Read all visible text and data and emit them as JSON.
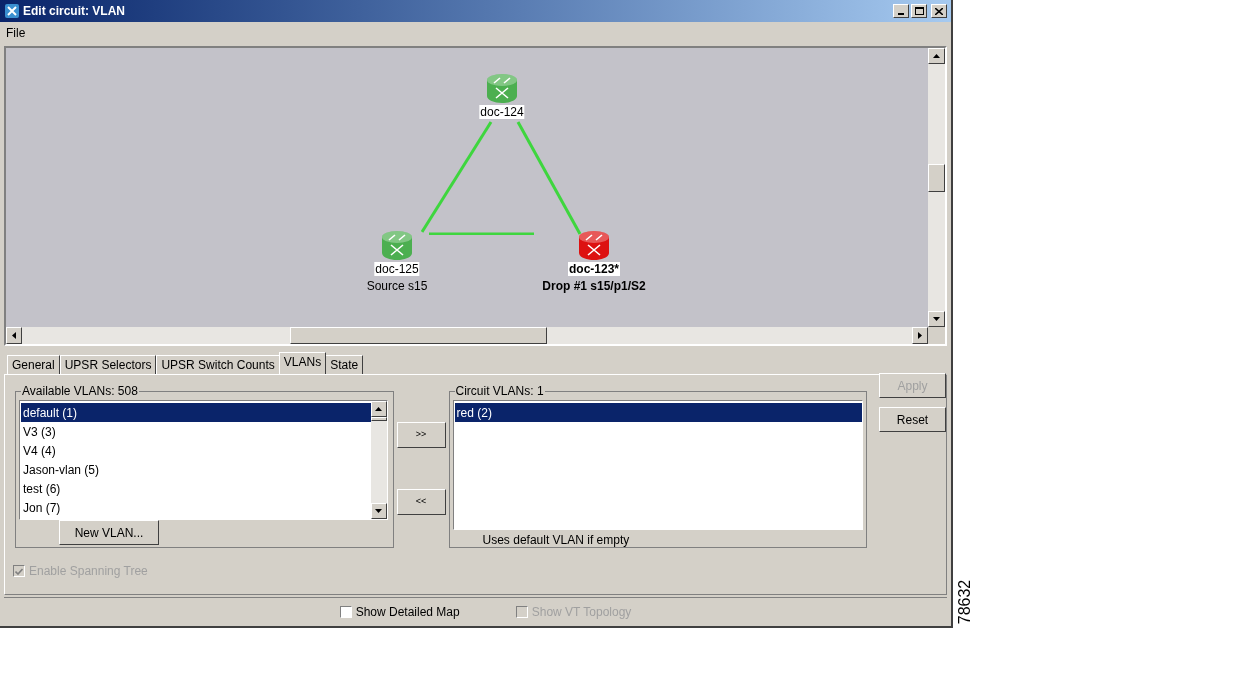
{
  "window": {
    "title": "Edit circuit: VLAN"
  },
  "menu": [
    "File"
  ],
  "map": {
    "nodes": [
      {
        "name": "doc-124",
        "color": "#4caf50",
        "selected": false
      },
      {
        "name": "doc-125",
        "subtitle": "Source s15",
        "color": "#4caf50",
        "selected": false
      },
      {
        "name": "doc-123*",
        "subtitle": "Drop #1 s15/p1/S2",
        "color": "#dd1111",
        "selected": true
      }
    ]
  },
  "tabs": [
    {
      "label": "General",
      "selected": false
    },
    {
      "label": "UPSR Selectors",
      "selected": false
    },
    {
      "label": "UPSR Switch Counts",
      "selected": false
    },
    {
      "label": "VLANs",
      "selected": true
    },
    {
      "label": "State",
      "selected": false
    }
  ],
  "available_vlans": {
    "title": "Available VLANs: 508",
    "items": [
      {
        "label": "default (1)",
        "selected": true
      },
      {
        "label": "V3 (3)",
        "selected": false
      },
      {
        "label": "V4 (4)",
        "selected": false
      },
      {
        "label": "Jason-vlan (5)",
        "selected": false
      },
      {
        "label": "test (6)",
        "selected": false
      },
      {
        "label": "Jon (7)",
        "selected": false
      }
    ],
    "button": "New VLAN..."
  },
  "move_buttons": [
    ">>",
    "<<"
  ],
  "circuit_vlans": {
    "title": "Circuit VLANs: 1",
    "items": [
      {
        "label": "red (2)",
        "selected": true
      }
    ],
    "note": "Uses default VLAN if empty"
  },
  "side_buttons": [
    {
      "label": "Apply",
      "disabled": true
    },
    {
      "label": "Reset",
      "disabled": false
    }
  ],
  "enable_spanning_tree": {
    "label": "Enable Spanning Tree",
    "checked": true,
    "disabled": true
  },
  "bottom_options": [
    {
      "label": "Show Detailed Map",
      "checked": false,
      "disabled": false
    },
    {
      "label": "Show VT Topology",
      "checked": false,
      "disabled": true
    }
  ],
  "figure_number": "78632"
}
